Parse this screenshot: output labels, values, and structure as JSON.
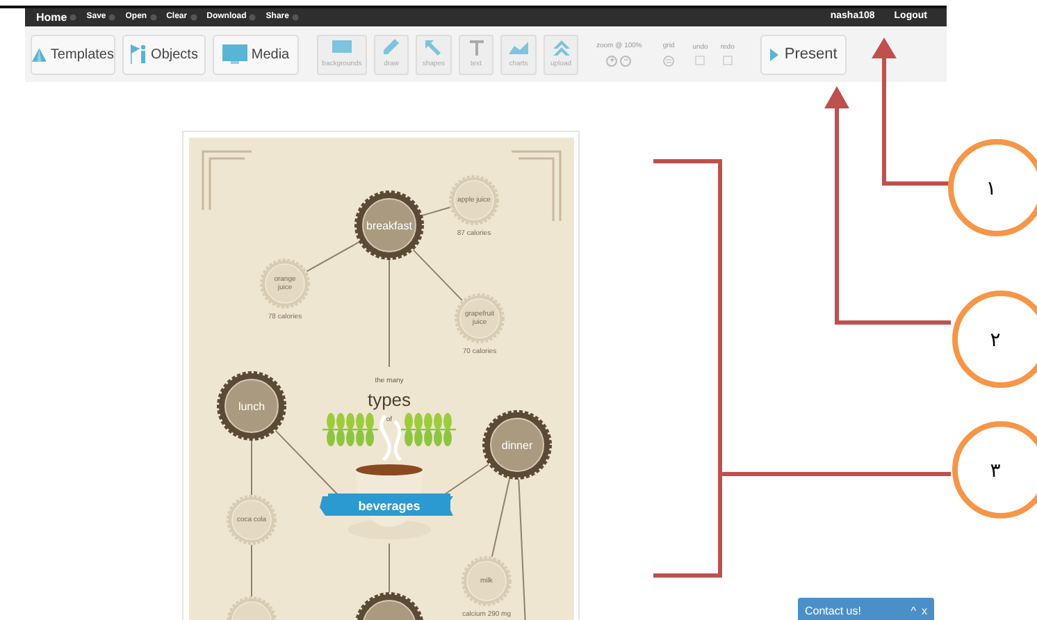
{
  "menu_bar": {
    "items": [
      {
        "label": "Home"
      },
      {
        "label": "Save"
      },
      {
        "label": "Open"
      },
      {
        "label": "Clear"
      },
      {
        "label": "Download"
      },
      {
        "label": "Share"
      }
    ],
    "user": "nasha108",
    "logout": "Logout"
  },
  "toolbar": {
    "panels": [
      {
        "label": "Templates"
      },
      {
        "label": "Objects"
      },
      {
        "label": "Media"
      }
    ],
    "tools": [
      {
        "label": "backgrounds"
      },
      {
        "label": "draw"
      },
      {
        "label": "shapes"
      },
      {
        "label": "text"
      },
      {
        "label": "charts"
      },
      {
        "label": "upload"
      }
    ],
    "zoom": {
      "label": "zoom @ 100%",
      "zoom_in": "+",
      "zoom_out": "−"
    },
    "grid": "grid",
    "undo": "undo",
    "redo": "redo",
    "present": "Present"
  },
  "infographic": {
    "title_top": "the many",
    "title_main": "types",
    "title_connector": "of",
    "banner": "beverages",
    "nodes": [
      {
        "kind": "main",
        "label": "breakfast"
      },
      {
        "kind": "side",
        "label": "apple juice",
        "caption": "87 calories"
      },
      {
        "kind": "side",
        "label": "orange juice",
        "caption": "78 calories"
      },
      {
        "kind": "side",
        "label": "grapefruit juice",
        "caption": "70 calories"
      },
      {
        "kind": "main",
        "label": "lunch"
      },
      {
        "kind": "main",
        "label": "dinner"
      },
      {
        "kind": "side",
        "label": "coca cola"
      },
      {
        "kind": "side",
        "label": "milk",
        "caption": "calcium 290 mg"
      },
      {
        "kind": "side"
      },
      {
        "kind": "main"
      }
    ]
  },
  "callouts": [
    {
      "number": "١"
    },
    {
      "number": "٢"
    },
    {
      "number": "٣"
    }
  ],
  "contact_widget": {
    "label": "Contact us!",
    "minimize": "^",
    "close": "x"
  }
}
